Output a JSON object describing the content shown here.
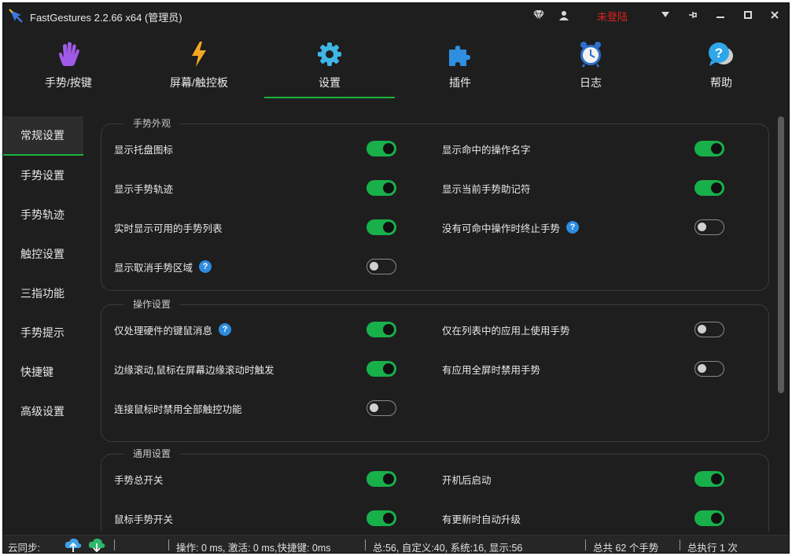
{
  "app": {
    "title": "FastGestures 2.2.66 x64  (管理员)",
    "login_status": "未登陆",
    "login_color": "#e02020",
    "accent_color": "#19b33a",
    "icons": [
      "diamond-icon",
      "user-icon",
      "dropdown-arrow-icon",
      "pin-icon",
      "minimize-icon",
      "maximize-icon",
      "close-icon"
    ]
  },
  "nav": {
    "active_tab": "设置",
    "tabs": [
      {
        "label": "手势/按键",
        "icon": "hand-icon"
      },
      {
        "label": "屏幕/触控板",
        "icon": "lightning-icon"
      },
      {
        "label": "设置",
        "icon": "gear-icon"
      },
      {
        "label": "插件",
        "icon": "puzzle-icon"
      },
      {
        "label": "日志",
        "icon": "alarm-clock-icon"
      },
      {
        "label": "帮助",
        "icon": "help-bubble-icon"
      }
    ]
  },
  "sidebar": {
    "active_item": "常规设置",
    "items": [
      {
        "label": "常规设置"
      },
      {
        "label": "手势设置"
      },
      {
        "label": "手势轨迹"
      },
      {
        "label": "触控设置"
      },
      {
        "label": "三指功能"
      },
      {
        "label": "手势提示"
      },
      {
        "label": "快捷键"
      },
      {
        "label": "高级设置"
      }
    ]
  },
  "groups": [
    {
      "title": "手势外观",
      "settings": [
        {
          "label": "显示托盘图标",
          "on": true,
          "help": false
        },
        {
          "label": "显示命中的操作名字",
          "on": true,
          "help": false
        },
        {
          "label": "显示手势轨迹",
          "on": true,
          "help": false
        },
        {
          "label": "显示当前手势助记符",
          "on": true,
          "help": false
        },
        {
          "label": "实时显示可用的手势列表",
          "on": true,
          "help": false
        },
        {
          "label": "没有可命中操作时终止手势",
          "on": false,
          "help": true
        },
        {
          "label": "显示取消手势区域",
          "on": false,
          "help": true
        }
      ]
    },
    {
      "title": "操作设置",
      "settings": [
        {
          "label": "仅处理硬件的键鼠消息",
          "on": true,
          "help": true
        },
        {
          "label": "仅在列表中的应用上使用手势",
          "on": false,
          "help": false
        },
        {
          "label": "边缘滚动,鼠标在屏幕边缘滚动时触发",
          "on": true,
          "help": false
        },
        {
          "label": "有应用全屏时禁用手势",
          "on": false,
          "help": false
        },
        {
          "label": "连接鼠标时禁用全部触控功能",
          "on": false,
          "help": false
        }
      ]
    },
    {
      "title": "通用设置",
      "settings": [
        {
          "label": "手势总开关",
          "on": true,
          "help": false
        },
        {
          "label": "开机后启动",
          "on": true,
          "help": false
        },
        {
          "label": "鼠标手势开关",
          "on": true,
          "help": false
        },
        {
          "label": "有更新时自动升级",
          "on": true,
          "help": false
        }
      ]
    }
  ],
  "help_glyph": "?",
  "statusbar": {
    "cloud_sync_label": "云同步:",
    "operation": "操作: 0 ms, 激活: 0 ms,快捷键: 0ms",
    "counts": "总:56, 自定义:40, 系统:16, 显示:56",
    "total_gestures": "总共 62 个手势",
    "total_executed": "总执行 1 次"
  }
}
